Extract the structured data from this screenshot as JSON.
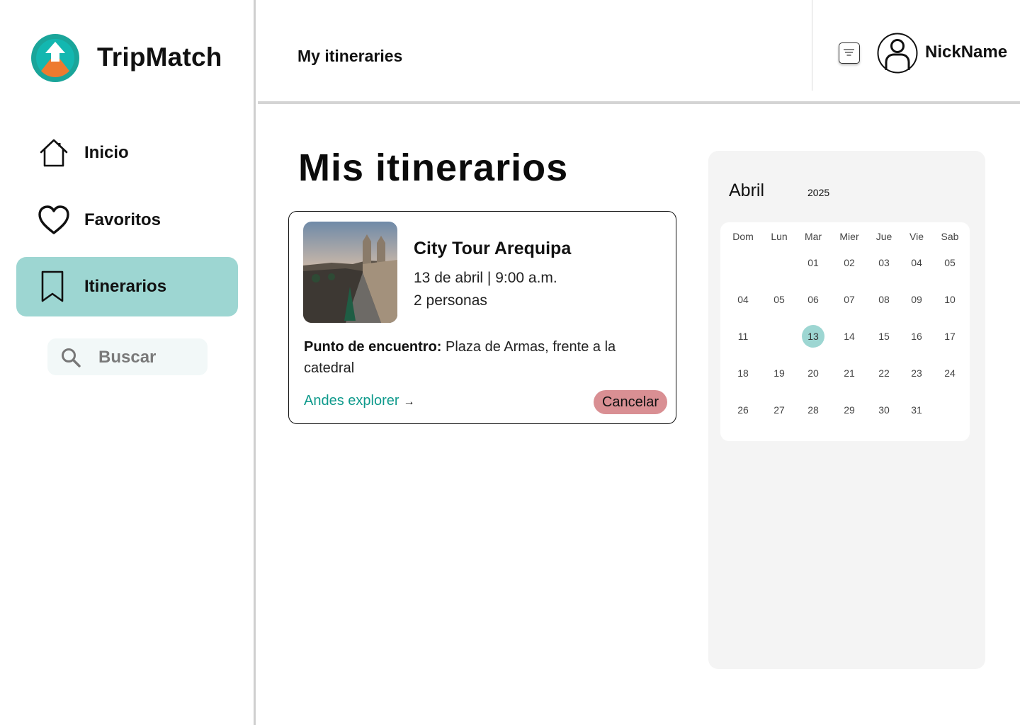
{
  "brand": {
    "name": "TripMatch"
  },
  "sidebar": {
    "items": [
      {
        "label": "Inicio",
        "icon": "home-icon",
        "active": false
      },
      {
        "label": "Favoritos",
        "icon": "heart-icon",
        "active": false
      },
      {
        "label": "Itinerarios",
        "icon": "bookmark-icon",
        "active": true
      }
    ],
    "search": {
      "placeholder": "Buscar",
      "icon": "search-icon"
    }
  },
  "header": {
    "title": "My itineraries",
    "filter_icon": "filter-icon",
    "user": {
      "nickname": "NickName",
      "avatar_icon": "user-avatar-icon"
    }
  },
  "main": {
    "title": "Mis itinerarios",
    "itineraries": [
      {
        "title": "City Tour Arequipa",
        "date_time": "13 de abril | 9:00 a.m.",
        "people": "2 personas",
        "meeting_label": "Punto de encuentro:",
        "meeting_point": " Plaza de Armas, frente a la catedral",
        "agency": "Andes explorer",
        "agency_arrow": "→",
        "cancel_label": "Cancelar"
      }
    ]
  },
  "calendar": {
    "month": "Abril",
    "year": "2025",
    "weekdays": [
      "Dom",
      "Lun",
      "Mar",
      "Mier",
      "Jue",
      "Vie",
      "Sab"
    ],
    "weeks": [
      [
        "",
        "",
        "01",
        "02",
        "03",
        "04",
        "05"
      ],
      [
        "04",
        "05",
        "06",
        "07",
        "08",
        "09",
        "10"
      ],
      [
        "11",
        "",
        "13",
        "14",
        "15",
        "16",
        "17"
      ],
      [
        "18",
        "19",
        "20",
        "21",
        "22",
        "23",
        "24"
      ],
      [
        "26",
        "27",
        "28",
        "29",
        "30",
        "31",
        ""
      ]
    ],
    "selected_day": "13"
  },
  "colors": {
    "accent": "#9dd6d2",
    "link": "#0f9a8c",
    "cancel": "#d98f93",
    "logo_teal": "#1aa59a",
    "logo_orange": "#ee7a2f"
  }
}
